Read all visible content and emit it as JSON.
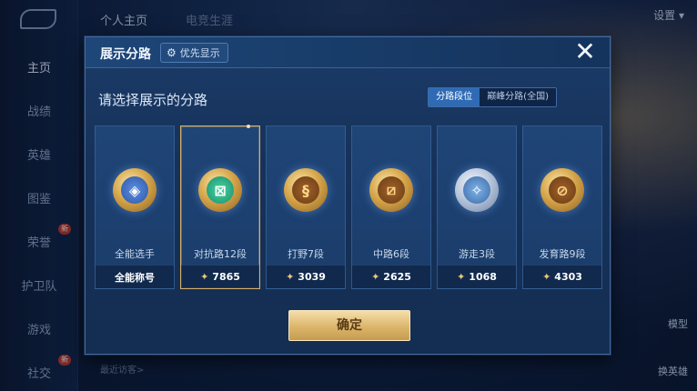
{
  "background": {
    "nav_items": [
      {
        "label": "主页",
        "active": true
      },
      {
        "label": "战绩",
        "active": false
      },
      {
        "label": "英雄",
        "active": false
      },
      {
        "label": "图鉴",
        "active": false
      },
      {
        "label": "荣誉",
        "active": false,
        "badge": "新"
      },
      {
        "label": "护卫队",
        "active": false
      },
      {
        "label": "游戏",
        "active": false
      },
      {
        "label": "社交",
        "active": false,
        "badge": "新"
      }
    ],
    "top_tabs": [
      "个人主页",
      "电竞生涯"
    ],
    "settings_label": "设置",
    "recent_visitors_label": "最近访客>",
    "right_buttons": [
      "模型",
      "换英雄"
    ]
  },
  "dialog": {
    "title": "展示分路",
    "priority_label": "优先显示",
    "close_icon": "close-icon",
    "subtitle": "请选择展示的分路",
    "toggle": {
      "options": [
        "分路段位",
        "巅峰分路(全国)"
      ],
      "selected_index": 0
    },
    "cards": [
      {
        "name": "全能选手",
        "footer": "全能称号",
        "emblem": "blue",
        "has_star": false,
        "selected": false
      },
      {
        "name": "对抗路12段",
        "footer": "7865",
        "emblem": "green",
        "has_star": true,
        "selected": true
      },
      {
        "name": "打野7段",
        "footer": "3039",
        "emblem": "gold",
        "has_star": true,
        "selected": false
      },
      {
        "name": "中路6段",
        "footer": "2625",
        "emblem": "gold",
        "has_star": true,
        "selected": false
      },
      {
        "name": "游走3段",
        "footer": "1068",
        "emblem": "silver",
        "has_star": true,
        "selected": false
      },
      {
        "name": "发育路9段",
        "footer": "4303",
        "emblem": "gold",
        "has_star": true,
        "selected": false
      }
    ],
    "confirm_label": "确定"
  }
}
